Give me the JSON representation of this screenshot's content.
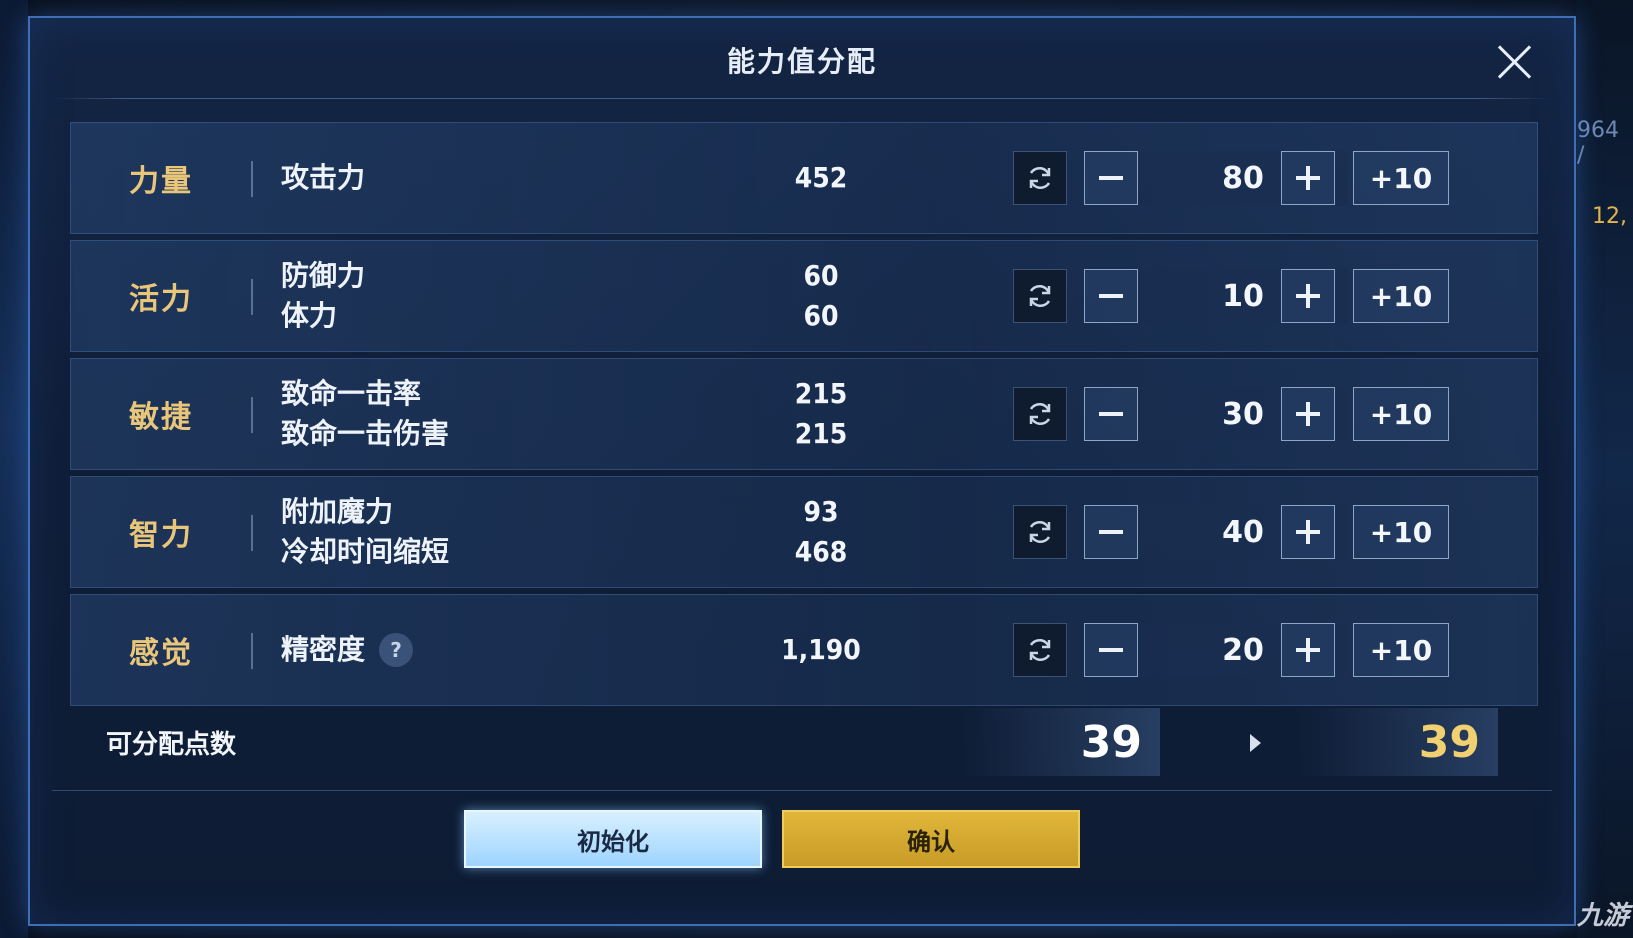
{
  "dialog": {
    "title": "能力值分配"
  },
  "stats": [
    {
      "name": "力量",
      "attributes": [
        {
          "label": "攻击力",
          "value": "452"
        }
      ],
      "allocated": "80",
      "plus10_label": "+10"
    },
    {
      "name": "活力",
      "attributes": [
        {
          "label": "防御力",
          "value": "60"
        },
        {
          "label": "体力",
          "value": "60"
        }
      ],
      "allocated": "10",
      "plus10_label": "+10"
    },
    {
      "name": "敏捷",
      "attributes": [
        {
          "label": "致命一击率",
          "value": "215"
        },
        {
          "label": "致命一击伤害",
          "value": "215"
        }
      ],
      "allocated": "30",
      "plus10_label": "+10"
    },
    {
      "name": "智力",
      "attributes": [
        {
          "label": "附加魔力",
          "value": "93"
        },
        {
          "label": "冷却时间缩短",
          "value": "468"
        }
      ],
      "allocated": "40",
      "plus10_label": "+10"
    },
    {
      "name": "感觉",
      "attributes": [
        {
          "label": "精密度",
          "value": "1,190",
          "help": "?"
        }
      ],
      "allocated": "20",
      "plus10_label": "+10"
    }
  ],
  "points": {
    "label": "可分配点数",
    "current": "39",
    "after": "39"
  },
  "buttons": {
    "init_label": "初始化",
    "confirm_label": "确认"
  },
  "background": {
    "right_texts": [
      "964 /",
      "12,"
    ],
    "watermark": "九游"
  },
  "colors": {
    "stat_name": "#e9c67a",
    "points_after": "#f0d070",
    "init_button": "#9ed4ff",
    "confirm_button": "#d4a92f",
    "dialog_border": "#3e6fb5"
  },
  "icons": {
    "close": "close-icon",
    "reset": "refresh-icon",
    "minus": "minus-icon",
    "plus": "plus-icon",
    "arrow": "arrow-right-icon",
    "help": "help-icon"
  }
}
